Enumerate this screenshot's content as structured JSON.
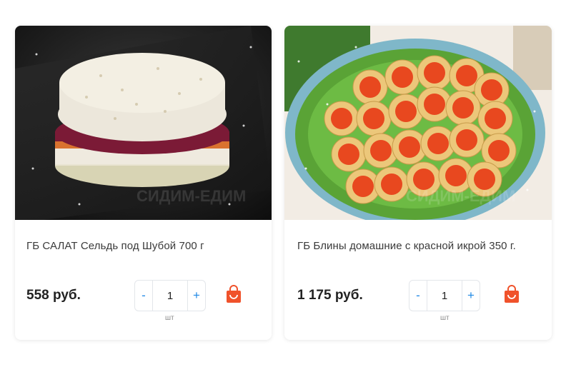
{
  "products": [
    {
      "title": "ГБ САЛАТ Сельдь под Шубой 700 г",
      "price": "558 руб.",
      "quantity": "1",
      "unit": "шт",
      "minus": "-",
      "plus": "+",
      "watermark": "СИДИМ-ЕДИМ"
    },
    {
      "title": "ГБ Блины домашние с красной икрой 350 г.",
      "price": "1 175 руб.",
      "quantity": "1",
      "unit": "шт",
      "minus": "-",
      "plus": "+",
      "watermark": "СИДИМ-ЕДИМ"
    }
  ],
  "icons": {
    "cart": "shopping-bag-icon"
  },
  "colors": {
    "accent": "#1e88e5",
    "cart": "#f0522b"
  }
}
